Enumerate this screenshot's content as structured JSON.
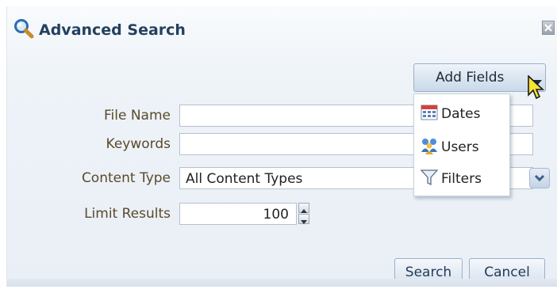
{
  "dialog": {
    "title": "Advanced Search",
    "icons": {
      "title": "magnifier-icon",
      "close": "close-icon"
    }
  },
  "form": {
    "file_name_label": "File Name",
    "file_name_value": "",
    "keywords_label": "Keywords",
    "keywords_value": "",
    "content_type_label": "Content Type",
    "content_type_value": "All Content Types",
    "limit_results_label": "Limit Results",
    "limit_results_value": "100"
  },
  "add_fields": {
    "label": "Add Fields",
    "menu": [
      {
        "label": "Dates",
        "icon": "calendar-icon"
      },
      {
        "label": "Users",
        "icon": "users-icon"
      },
      {
        "label": "Filters",
        "icon": "filter-icon"
      }
    ]
  },
  "buttons": {
    "search": "Search",
    "cancel": "Cancel"
  },
  "colors": {
    "title": "#23415f",
    "label": "#5a4a2a",
    "panel_bg": "#eef3f8"
  }
}
